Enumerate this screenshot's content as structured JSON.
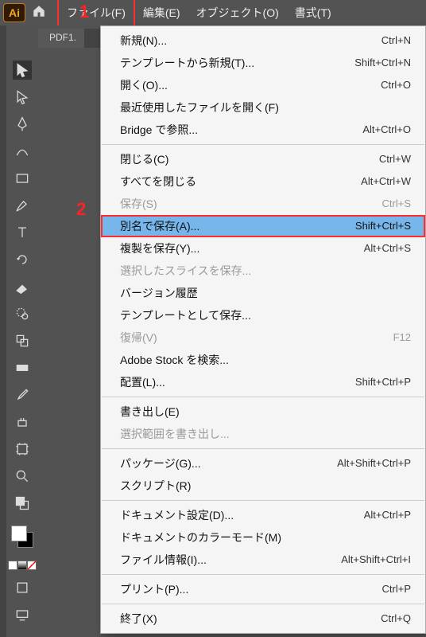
{
  "menubar": {
    "logo_text": "Ai",
    "items": [
      "ファイル(F)",
      "編集(E)",
      "オブジェクト(O)",
      "書式(T)"
    ]
  },
  "callouts": {
    "one": "1",
    "two": "2"
  },
  "document": {
    "tab_label": "PDF1."
  },
  "dropdown": {
    "groups": [
      [
        {
          "label": "新規(N)...",
          "shortcut": "Ctrl+N"
        },
        {
          "label": "テンプレートから新規(T)...",
          "shortcut": "Shift+Ctrl+N"
        },
        {
          "label": "開く(O)...",
          "shortcut": "Ctrl+O"
        },
        {
          "label": "最近使用したファイルを開く(F)",
          "submenu": true
        },
        {
          "label": "Bridge で参照...",
          "shortcut": "Alt+Ctrl+O"
        }
      ],
      [
        {
          "label": "閉じる(C)",
          "shortcut": "Ctrl+W"
        },
        {
          "label": "すべてを閉じる",
          "shortcut": "Alt+Ctrl+W"
        },
        {
          "label": "保存(S)",
          "shortcut": "Ctrl+S",
          "disabled": true
        },
        {
          "label": "別名で保存(A)...",
          "shortcut": "Shift+Ctrl+S",
          "highlight": true
        },
        {
          "label": "複製を保存(Y)...",
          "shortcut": "Alt+Ctrl+S"
        },
        {
          "label": "選択したスライスを保存...",
          "disabled": true
        },
        {
          "label": "バージョン履歴"
        },
        {
          "label": "テンプレートとして保存..."
        },
        {
          "label": "復帰(V)",
          "shortcut": "F12",
          "disabled": true
        },
        {
          "label": "Adobe Stock を検索..."
        },
        {
          "label": "配置(L)...",
          "shortcut": "Shift+Ctrl+P"
        }
      ],
      [
        {
          "label": "書き出し(E)",
          "submenu": true
        },
        {
          "label": "選択範囲を書き出し...",
          "disabled": true
        }
      ],
      [
        {
          "label": "パッケージ(G)...",
          "shortcut": "Alt+Shift+Ctrl+P"
        },
        {
          "label": "スクリプト(R)",
          "submenu": true
        }
      ],
      [
        {
          "label": "ドキュメント設定(D)...",
          "shortcut": "Alt+Ctrl+P"
        },
        {
          "label": "ドキュメントのカラーモード(M)",
          "submenu": true
        },
        {
          "label": "ファイル情報(I)...",
          "shortcut": "Alt+Shift+Ctrl+I"
        }
      ],
      [
        {
          "label": "プリント(P)...",
          "shortcut": "Ctrl+P"
        }
      ],
      [
        {
          "label": "終了(X)",
          "shortcut": "Ctrl+Q"
        }
      ]
    ]
  }
}
